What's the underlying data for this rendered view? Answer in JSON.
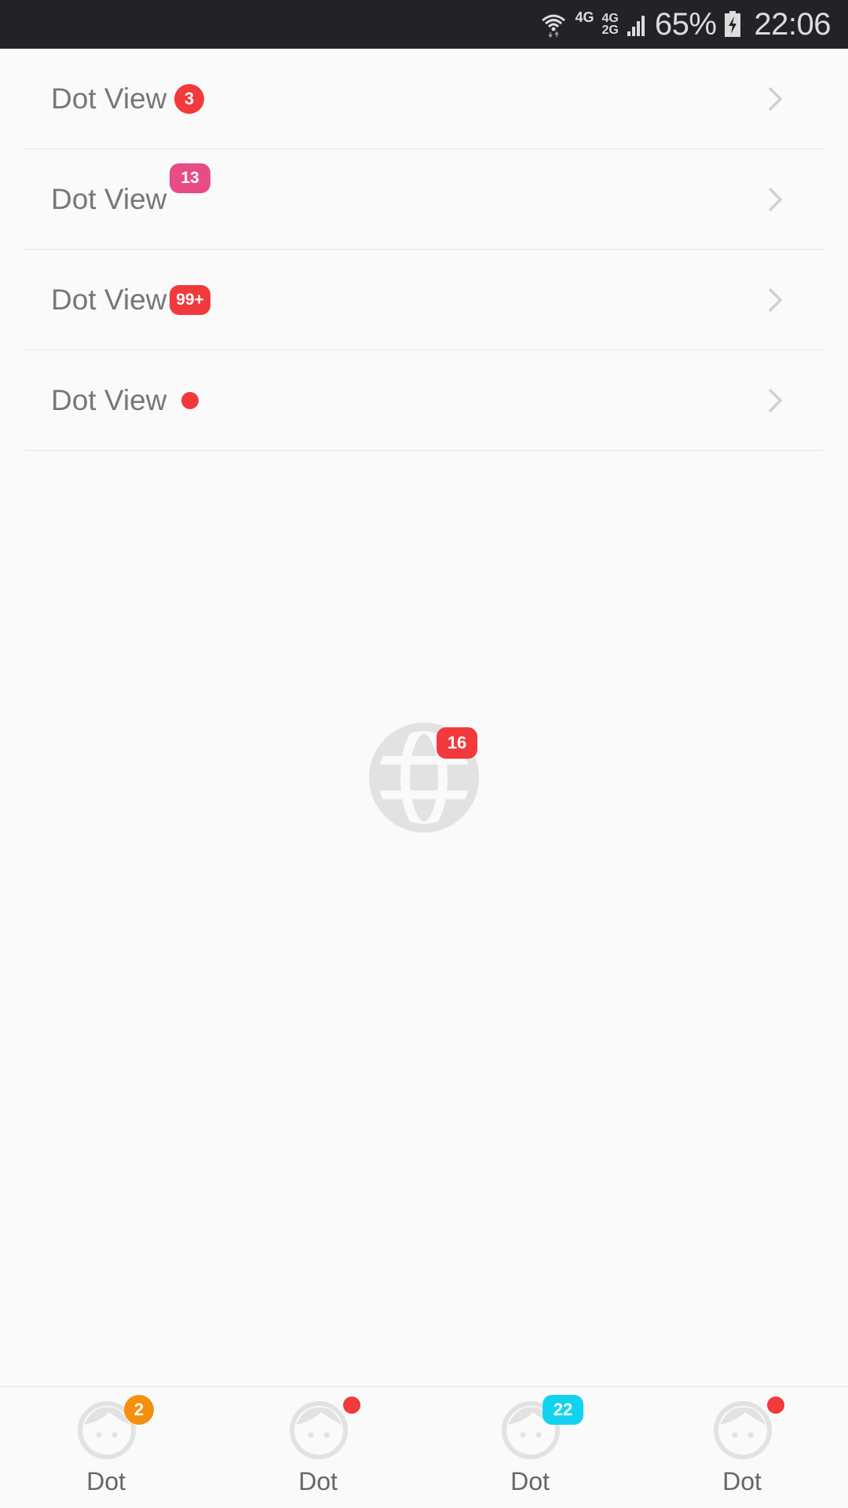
{
  "status_bar": {
    "network_top": "4G",
    "network_stack_top": "4G",
    "network_stack_bottom": "2G",
    "battery": "65%",
    "time": "22:06",
    "icons": [
      "wifi-icon",
      "signal-icon",
      "battery-charging-icon"
    ]
  },
  "list": {
    "items": [
      {
        "label": "Dot View",
        "badge": "3",
        "badge_style": "circle",
        "badge_color": "#f2393b"
      },
      {
        "label": "Dot View",
        "badge": "13",
        "badge_style": "rounded-rect",
        "badge_color": "#e74c86"
      },
      {
        "label": "Dot View",
        "badge": "99+",
        "badge_style": "rounded-rect",
        "badge_color": "#f2393b"
      },
      {
        "label": "Dot View",
        "badge": "",
        "badge_style": "dot",
        "badge_color": "#f2393b"
      }
    ],
    "chevron_icon": "chevron-right-icon"
  },
  "center": {
    "icon": "globe-icon",
    "badge": "16",
    "badge_color": "#f2393b"
  },
  "tabs": [
    {
      "label": "Dot",
      "icon": "face-icon",
      "badge": "2",
      "badge_color": "#f68f0d"
    },
    {
      "label": "Dot",
      "icon": "face-icon",
      "badge": "",
      "badge_color": "#f2393b"
    },
    {
      "label": "Dot",
      "icon": "face-icon",
      "badge": "22",
      "badge_color": "#12d3ef"
    },
    {
      "label": "Dot",
      "icon": "face-icon",
      "badge": "",
      "badge_color": "#f2393b"
    }
  ],
  "colors": {
    "background": "#fafafa",
    "status_bar": "#222327",
    "label_text": "#777777",
    "icon_gray": "#e2e2e2"
  }
}
